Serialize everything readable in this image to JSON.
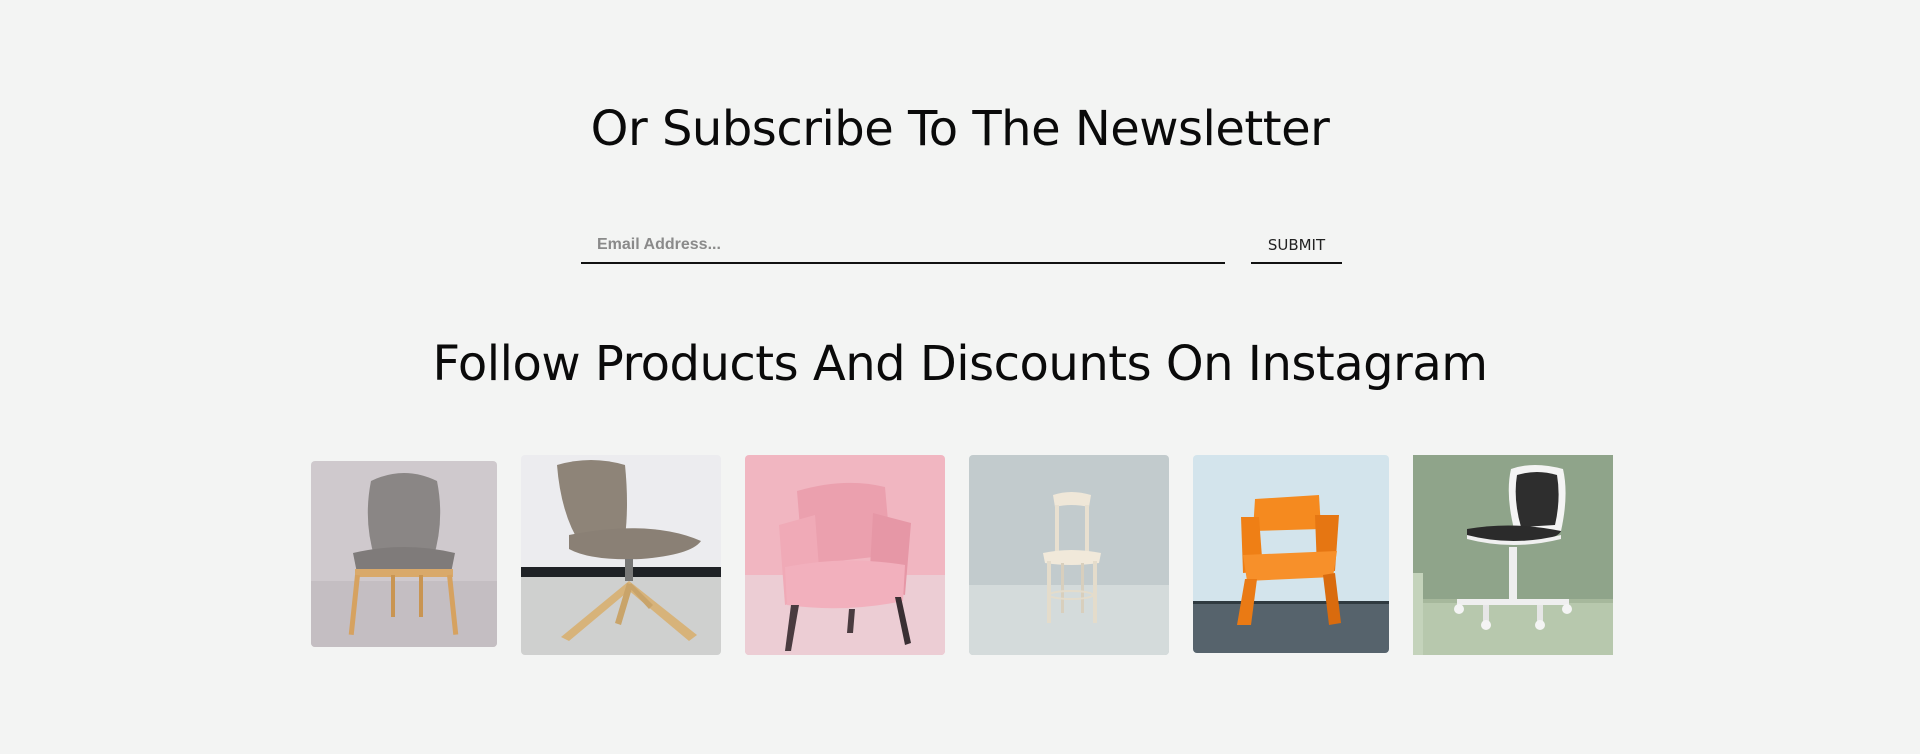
{
  "newsletter": {
    "title": "Or Subscribe To The Newsletter",
    "email_placeholder": "Email Address...",
    "submit_label": "SUBMIT"
  },
  "instagram": {
    "title": "Follow Products And Discounts On Instagram",
    "images": [
      {
        "name": "grey-upholstered-dining-chair",
        "bg": "#cfc9cd",
        "accent": "#8a8685"
      },
      {
        "name": "grey-swivel-lounge-chair",
        "bg": "#e9e9ec",
        "accent": "#8e8478"
      },
      {
        "name": "pink-tufted-armchair",
        "bg": "#f1b6c1",
        "accent": "#e8a3b0"
      },
      {
        "name": "white-bentwood-chair",
        "bg": "#c2cbcd",
        "accent": "#efe7d8"
      },
      {
        "name": "orange-plastic-chair",
        "bg": "#c9dde6",
        "accent": "#f58a1f"
      },
      {
        "name": "white-black-office-chair",
        "bg": "#8fa48a",
        "accent": "#2e2e2e"
      }
    ]
  }
}
